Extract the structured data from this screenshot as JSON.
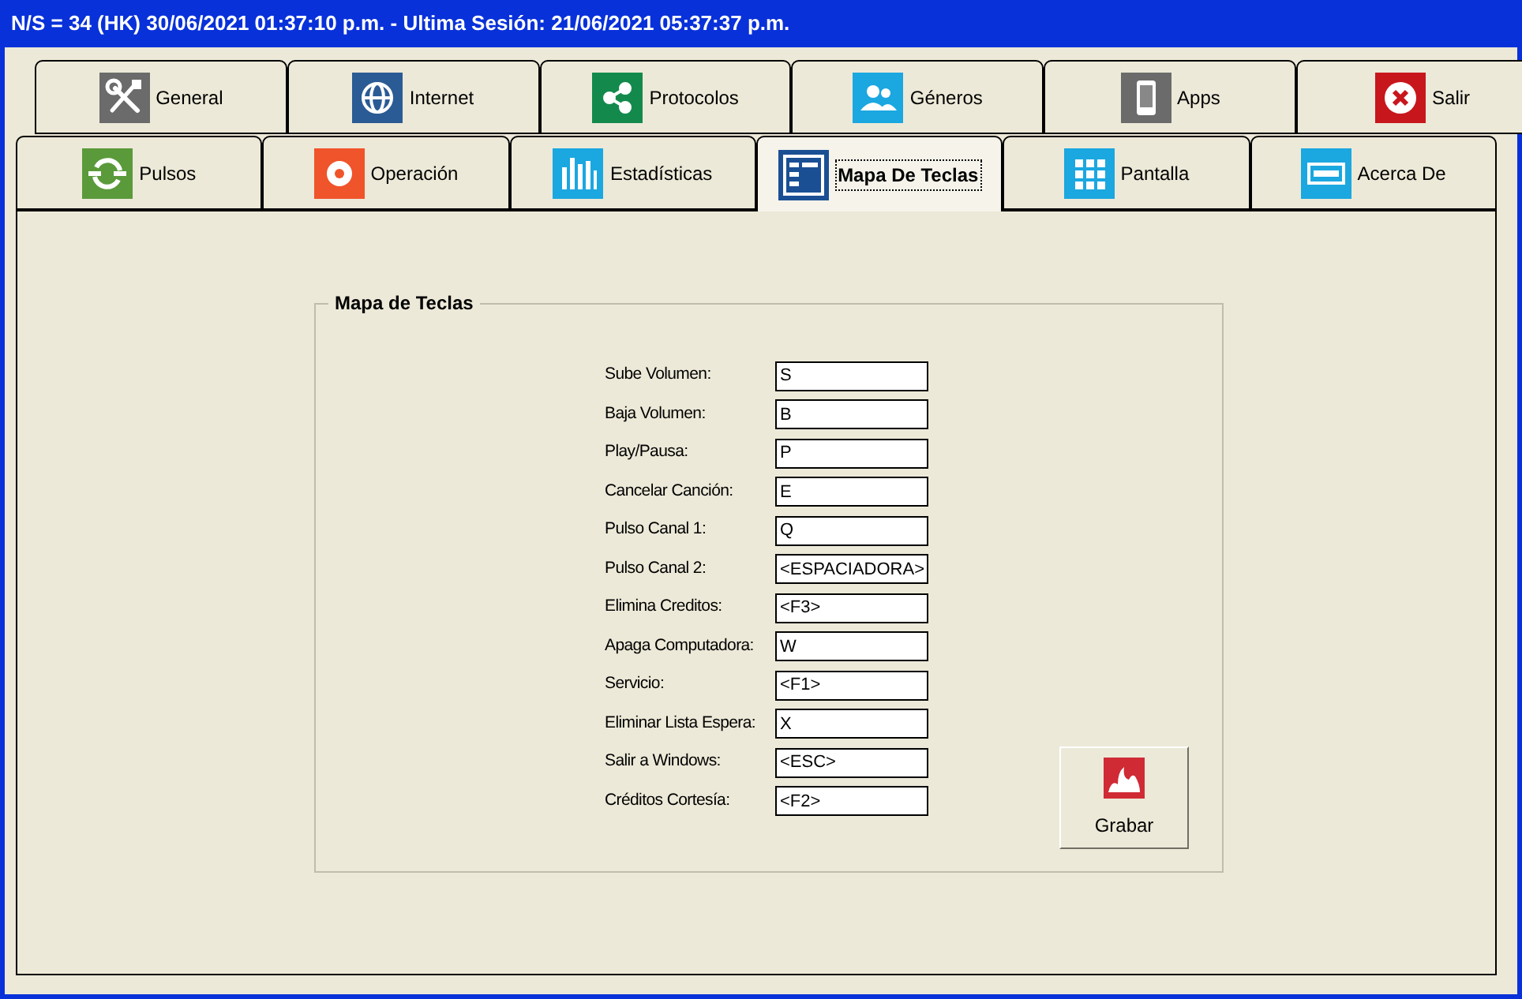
{
  "window": {
    "title": "N/S = 34 (HK) 30/06/2021 01:37:10 p.m. - Ultima Sesión: 21/06/2021 05:37:37 p.m."
  },
  "tab_rows": [
    [
      {
        "label": "General",
        "selected": false
      },
      {
        "label": "Internet",
        "selected": false
      },
      {
        "label": "Protocolos",
        "selected": false
      },
      {
        "label": "Géneros",
        "selected": false
      },
      {
        "label": "Apps",
        "selected": false
      },
      {
        "label": "Salir",
        "selected": false
      }
    ],
    [
      {
        "label": "Pulsos",
        "selected": false
      },
      {
        "label": "Operación",
        "selected": false
      },
      {
        "label": "Estadísticas",
        "selected": false
      },
      {
        "label": "Mapa De Teclas",
        "selected": true
      },
      {
        "label": "Pantalla",
        "selected": false
      },
      {
        "label": "Acerca De",
        "selected": false
      }
    ]
  ],
  "group": {
    "title": "Mapa de Teclas",
    "fields": [
      {
        "label": "Sube Volumen:",
        "value": "S"
      },
      {
        "label": "Baja Volumen:",
        "value": "B"
      },
      {
        "label": "Play/Pausa:",
        "value": "P"
      },
      {
        "label": "Cancelar Canción:",
        "value": "E"
      },
      {
        "label": "Pulso Canal 1:",
        "value": "Q"
      },
      {
        "label": "Pulso Canal 2:",
        "value": "<ESPACIADORA>"
      },
      {
        "label": "Elimina Creditos:",
        "value": "<F3>"
      },
      {
        "label": "Apaga Computadora:",
        "value": "W"
      },
      {
        "label": "Servicio:",
        "value": "<F1>"
      },
      {
        "label": "Eliminar Lista Espera:",
        "value": "X"
      },
      {
        "label": "Salir a Windows:",
        "value": "<ESC>"
      },
      {
        "label": "Créditos Cortesía:",
        "value": "<F2>"
      }
    ],
    "save_button": "Grabar"
  }
}
